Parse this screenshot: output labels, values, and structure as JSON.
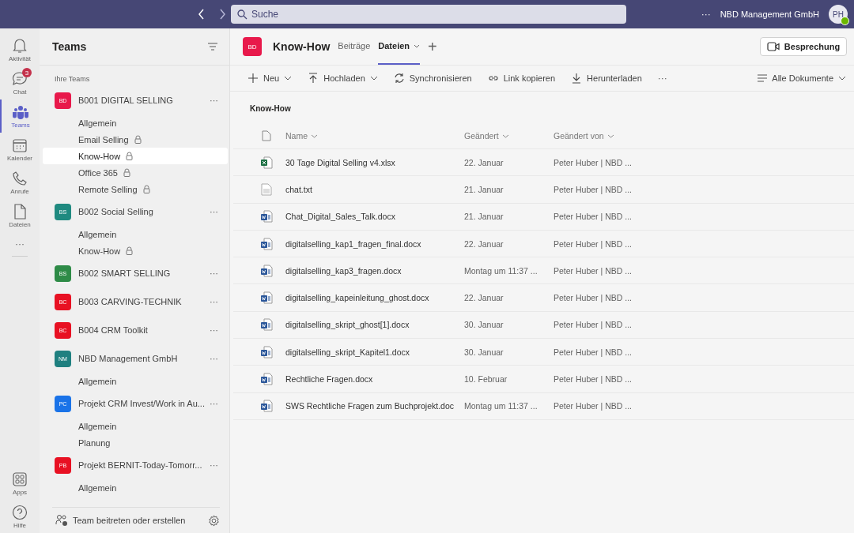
{
  "topbar": {
    "search": {
      "placeholder": "Suche"
    },
    "more": "···",
    "org": "NBD Management GmbH",
    "avatar": "PH"
  },
  "rail": [
    {
      "kind": "bell",
      "label": "Aktivität",
      "selected": false
    },
    {
      "kind": "chat",
      "label": "Chat",
      "selected": false,
      "badge": "3"
    },
    {
      "kind": "teams",
      "label": "Teams",
      "selected": true
    },
    {
      "kind": "calendar",
      "label": "Kalender",
      "selected": false
    },
    {
      "kind": "phone",
      "label": "Anrufe",
      "selected": false
    },
    {
      "kind": "file",
      "label": "Dateien",
      "selected": false
    }
  ],
  "rail_more": "···",
  "rail_bottom": [
    {
      "kind": "apps",
      "label": "Apps",
      "selected": false
    },
    {
      "kind": "help",
      "label": "Hilfe",
      "selected": false
    }
  ],
  "panel": {
    "title": "Teams",
    "section": "Ihre Teams",
    "footer": "Team beitreten oder erstellen",
    "teams": [
      {
        "initials": "BD",
        "color": "#e8194b",
        "name": "B001 DIGITAL SELLING",
        "channels": [
          {
            "name": "Allgemein",
            "locked": false,
            "selected": false
          },
          {
            "name": "Email Selling",
            "locked": true,
            "selected": false
          },
          {
            "name": "Know-How",
            "locked": true,
            "selected": true
          },
          {
            "name": "Office 365",
            "locked": true,
            "selected": false
          },
          {
            "name": "Remote Selling",
            "locked": true,
            "selected": false
          }
        ]
      },
      {
        "initials": "BS",
        "color": "#1f8a80",
        "name": "B002 Social Selling",
        "channels": [
          {
            "name": "Allgemein",
            "locked": false,
            "selected": false
          },
          {
            "name": "Know-How",
            "locked": true,
            "selected": false
          }
        ]
      },
      {
        "initials": "BS",
        "color": "#2e8b47",
        "name": "B002 SMART SELLING"
      },
      {
        "initials": "BC",
        "color": "#e81123",
        "name": "B003 CARVING-TECHNIK"
      },
      {
        "initials": "BC",
        "color": "#e81123",
        "name": "B004 CRM Toolkit"
      },
      {
        "initials": "NM",
        "color": "#1f8080",
        "name": "NBD Management GmbH",
        "channels": [
          {
            "name": "Allgemein",
            "locked": false,
            "selected": false
          }
        ]
      },
      {
        "initials": "PC",
        "color": "#1a73e8",
        "name": "Projekt CRM Invest/Work in Au...",
        "channels": [
          {
            "name": "Allgemein",
            "locked": false,
            "selected": false
          },
          {
            "name": "Planung",
            "locked": false,
            "selected": false
          }
        ]
      },
      {
        "initials": "PB",
        "color": "#e81123",
        "name": "Projekt BERNIT-Today-Tomorr...",
        "channels": [
          {
            "name": "Allgemein",
            "locked": false,
            "selected": false
          }
        ]
      }
    ],
    "team_more": "···"
  },
  "header": {
    "initials": "BD",
    "title": "Know-How",
    "tabs": [
      {
        "label": "Beiträge",
        "selected": false
      },
      {
        "label": "Dateien",
        "selected": true
      }
    ],
    "add": "+",
    "meeting": "Besprechung"
  },
  "toolbar": [
    {
      "kind": "plus",
      "label": "Neu",
      "caret": true
    },
    {
      "kind": "upload",
      "label": "Hochladen",
      "caret": true
    },
    {
      "kind": "sync",
      "label": "Synchronisieren",
      "caret": false
    },
    {
      "kind": "link",
      "label": "Link kopieren",
      "caret": false
    },
    {
      "kind": "download",
      "label": "Herunterladen",
      "caret": false
    }
  ],
  "toolbar_more": "···",
  "view": "Alle Dokumente",
  "folder": "Know-How",
  "table": {
    "columns": [
      "Name",
      "Geändert",
      "Geändert von"
    ],
    "rows": [
      {
        "kind": "xlsx",
        "name": "30 Tage Digital Selling v4.xlsx",
        "modified": "22. Januar",
        "by": "Peter Huber | NBD ..."
      },
      {
        "kind": "txt",
        "name": "chat.txt",
        "modified": "21. Januar",
        "by": "Peter Huber | NBD ..."
      },
      {
        "kind": "docx",
        "name": "Chat_Digital_Sales_Talk.docx",
        "modified": "21. Januar",
        "by": "Peter Huber | NBD ..."
      },
      {
        "kind": "docx",
        "name": "digitalselling_kap1_fragen_final.docx",
        "modified": "22. Januar",
        "by": "Peter Huber | NBD ..."
      },
      {
        "kind": "docx",
        "name": "digitalselling_kap3_fragen.docx",
        "modified": "Montag um 11:37 ...",
        "by": "Peter Huber | NBD ..."
      },
      {
        "kind": "docx",
        "name": "digitalselling_kapeinleitung_ghost.docx",
        "modified": "22. Januar",
        "by": "Peter Huber | NBD ..."
      },
      {
        "kind": "docx",
        "name": "digitalselling_skript_ghost[1].docx",
        "modified": "30. Januar",
        "by": "Peter Huber | NBD ..."
      },
      {
        "kind": "docx",
        "name": "digitalselling_skript_Kapitel1.docx",
        "modified": "30. Januar",
        "by": "Peter Huber | NBD ..."
      },
      {
        "kind": "docx",
        "name": "Rechtliche Fragen.docx",
        "modified": "10. Februar",
        "by": "Peter Huber | NBD ..."
      },
      {
        "kind": "docx",
        "name": "SWS Rechtliche Fragen zum Buchprojekt.doc",
        "modified": "Montag um 11:37 ...",
        "by": "Peter Huber | NBD ..."
      }
    ]
  }
}
